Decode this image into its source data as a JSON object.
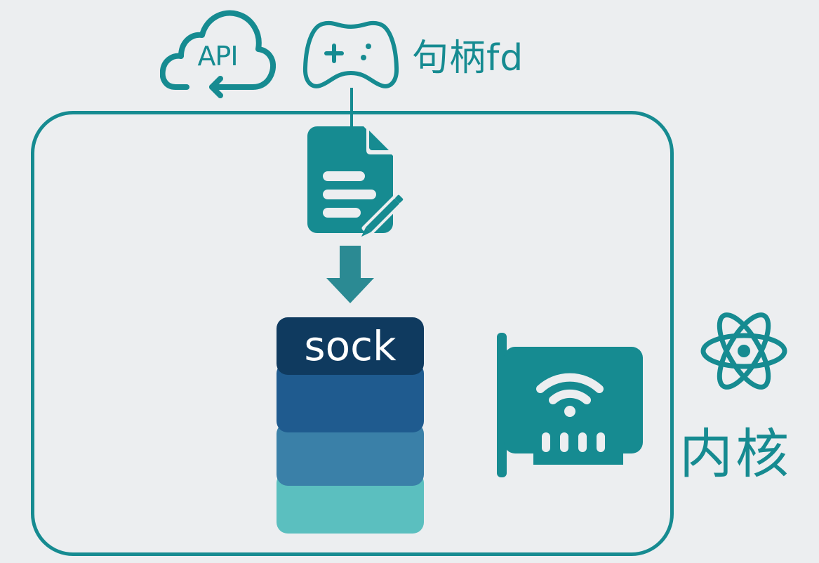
{
  "diagram": {
    "api_label": "API",
    "handle_label": "句柄fd",
    "sock_label": "sock",
    "kernel_label": "内核"
  },
  "colors": {
    "teal": "#168b91",
    "arrow": "#2b8a93",
    "sock_header": "#0f3a5f",
    "sock_layer_2": "#1f5b8f",
    "sock_layer_3": "#3a80a8",
    "sock_layer_4": "#5bbfbf",
    "background": "#eceef0"
  },
  "icons": {
    "cloud": "cloud-api-icon",
    "gamepad": "gamepad-icon",
    "document": "document-edit-icon",
    "network_card": "network-card-wifi-icon",
    "atom": "atom-icon"
  }
}
